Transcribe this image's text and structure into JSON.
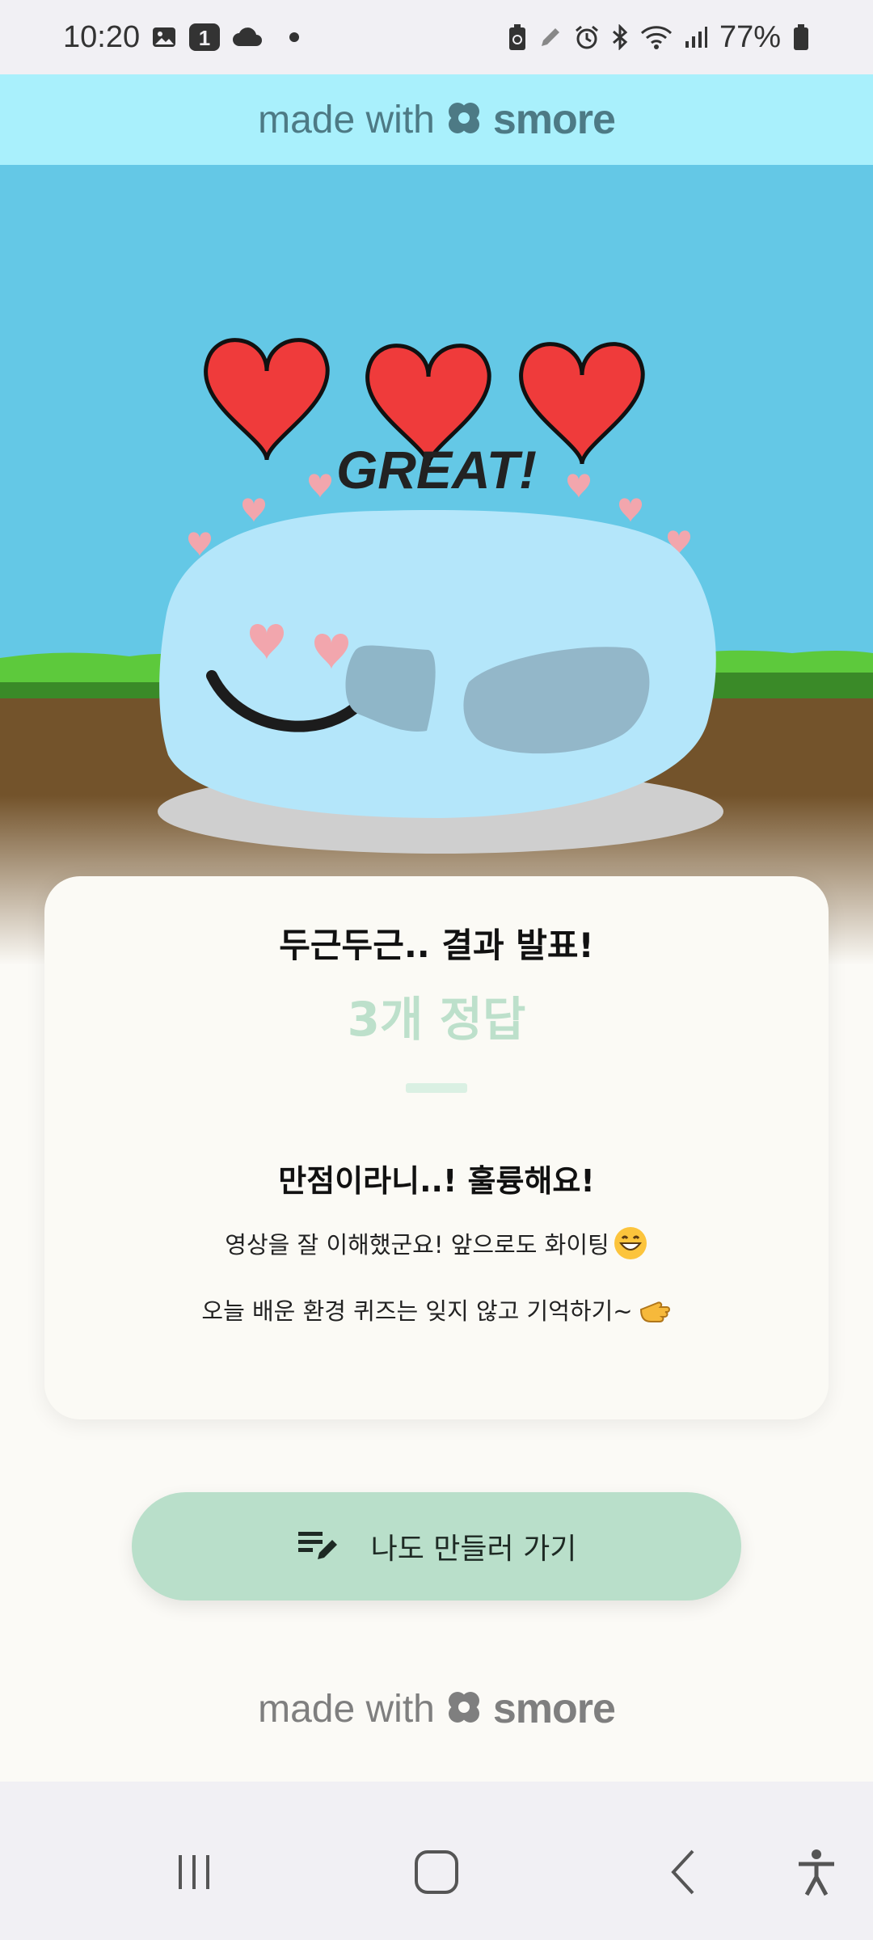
{
  "status_bar": {
    "time": "10:20",
    "battery": "77%",
    "left_icons": [
      "gallery-icon",
      "notification-count-icon",
      "cloud-icon",
      "dot-icon"
    ],
    "notification_count": "1",
    "right_icons": [
      "battery-saver-icon",
      "pen-icon",
      "alarm-icon",
      "bluetooth-icon",
      "wifi-icon",
      "signal-icon",
      "battery-icon"
    ]
  },
  "banner": {
    "made_with": "made with",
    "brand": "smore",
    "background": "#a9f0fc"
  },
  "hero": {
    "title": "GREAT!",
    "hearts": 3,
    "heart_color": "#ef3b3b"
  },
  "result_card": {
    "title": "두근두근.. 결과 발표!",
    "score": "3개 정답",
    "headline": "만점이라니..! 훌륭해요!",
    "line1": "영상을 잘 이해했군요! 앞으로도 화이팅",
    "line1_emoji": "grinning-face-icon",
    "line2": "오늘 배운 환경 퀴즈는 잊지 않고 기억하기~",
    "line2_emoji": "pointing-hand-icon"
  },
  "cta": {
    "label": "나도 만들러 가기",
    "icon": "edit-list-icon",
    "color": "#b9dfca"
  },
  "footer": {
    "made_with": "made with",
    "brand": "smore"
  },
  "nav_bar": {
    "buttons": [
      "recent-apps-icon",
      "home-icon",
      "back-icon",
      "accessibility-icon"
    ]
  }
}
